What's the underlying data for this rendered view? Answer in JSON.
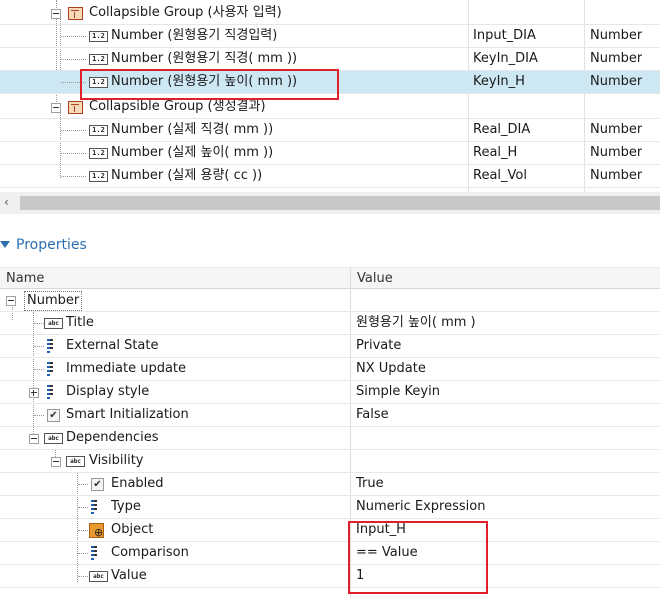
{
  "tree": {
    "rows": [
      {
        "label": "Collapsible Group (사용자 입력)",
        "name": "",
        "type": "",
        "kind": "group"
      },
      {
        "label": "Number (원형용기 직경입력)",
        "name": "Input_DIA",
        "type": "Number",
        "kind": "number"
      },
      {
        "label": "Number (원형용기 직경( mm ))",
        "name": "KeyIn_DIA",
        "type": "Number",
        "kind": "number"
      },
      {
        "label": "Number (원형용기 높이( mm ))",
        "name": "KeyIn_H",
        "type": "Number",
        "kind": "number",
        "selected": true
      },
      {
        "label": "Collapsible Group (생성결과)",
        "name": "",
        "type": "",
        "kind": "group"
      },
      {
        "label": "Number (실제 직경( mm ))",
        "name": "Real_DIA",
        "type": "Number",
        "kind": "number"
      },
      {
        "label": "Number (실제 높이( mm ))",
        "name": "Real_H",
        "type": "Number",
        "kind": "number"
      },
      {
        "label": "Number (실제 용량( cc ))",
        "name": "Real_Vol",
        "type": "Number",
        "kind": "number"
      }
    ],
    "scroll_left": "‹"
  },
  "properties": {
    "title": "Properties",
    "header": {
      "name": "Name",
      "value": "Value"
    },
    "rows": [
      {
        "name": "Number",
        "value": ""
      },
      {
        "name": "Title",
        "value": "원형용기 높이( mm )"
      },
      {
        "name": "External State",
        "value": "Private"
      },
      {
        "name": "Immediate update",
        "value": "NX Update"
      },
      {
        "name": "Display style",
        "value": "Simple Keyin"
      },
      {
        "name": "Smart Initialization",
        "value": "False"
      },
      {
        "name": "Dependencies",
        "value": ""
      },
      {
        "name": "Visibility",
        "value": ""
      },
      {
        "name": "Enabled",
        "value": "True"
      },
      {
        "name": "Type",
        "value": "Numeric Expression"
      },
      {
        "name": "Object",
        "value": "Input_H"
      },
      {
        "name": "Comparison",
        "value": "== Value"
      },
      {
        "name": "Value",
        "value": "1"
      }
    ]
  },
  "icons": {
    "number": "1.2",
    "abc": "abc",
    "check": "✔"
  },
  "colors": {
    "highlight": "#e0202a",
    "selected_row": "#cde8f3",
    "accent": "#2d6fb0"
  }
}
